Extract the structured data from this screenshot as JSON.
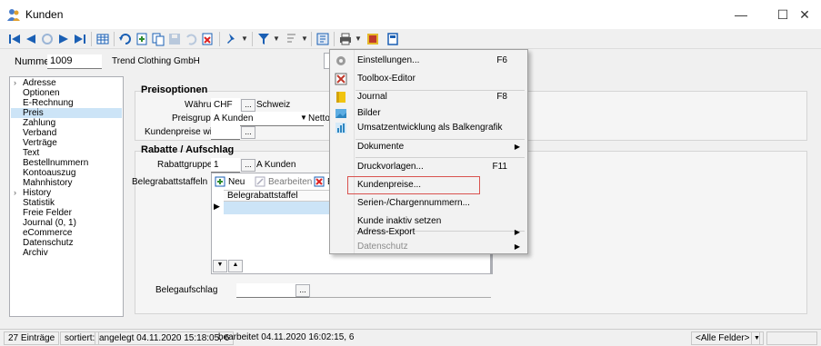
{
  "window": {
    "title": "Kunden",
    "minimize": "—",
    "maximize": "☐",
    "close": "✕"
  },
  "header": {
    "nummer_label": "Nummer",
    "nummer_value": "1009",
    "name_value": "Trend Clothing GmbH"
  },
  "nav": {
    "items": [
      "Adresse",
      "Optionen",
      "E-Rechnung",
      "Preis",
      "Zahlung",
      "Verband",
      "Verträge",
      "Text",
      "Bestellnummern",
      "Kontoauszug",
      "Mahnhistory",
      "History",
      "Statistik",
      "Freie Felder",
      "Journal (0, 1)",
      "eCommerce",
      "Datenschutz",
      "Archiv"
    ],
    "selected": "Preis"
  },
  "preis": {
    "group_title": "Preisoptionen",
    "waehrung_label": "Währung",
    "waehrung_value": "CHF",
    "waehrung_desc": "Schweiz",
    "preisgruppe_label": "Preisgruppe",
    "preisgruppe_value": "A Kunden",
    "netto_label": "Netto",
    "kundenpreise_label": "Kundenpreise wie"
  },
  "rabatte": {
    "group_title": "Rabatte / Aufschlag",
    "rabattgruppe_label": "Rabattgruppe",
    "rabattgruppe_value": "1",
    "rabattgruppe_desc": "A Kunden",
    "belegrabatt_label": "Belegrabattstaffeln",
    "neu_label": "Neu",
    "bearbeiten_label": "Bearbeiten",
    "entfernen_label": "En",
    "column_header": "Belegrabattstaffel",
    "belegaufschlag_label": "Belegaufschlag"
  },
  "menu": {
    "items": [
      {
        "label": "Einstellungen...",
        "key": "F6",
        "icon": "gear-icon"
      },
      {
        "label": "Toolbox-Editor",
        "key": "",
        "icon": "toolbox-icon"
      },
      {
        "label": "Journal",
        "key": "F8",
        "icon": "journal-icon"
      },
      {
        "label": "Bilder",
        "key": "",
        "icon": "picture-icon"
      },
      {
        "label": "Umsatzentwicklung als Balkengrafik",
        "key": "",
        "icon": "bar-chart-icon"
      },
      {
        "label": "Dokumente",
        "key": "",
        "icon": ""
      },
      {
        "label": "Druckvorlagen...",
        "key": "F11",
        "icon": ""
      },
      {
        "label": "Kundenpreise...",
        "key": "",
        "icon": ""
      },
      {
        "label": "Serien-/Chargennummern...",
        "key": "",
        "icon": ""
      },
      {
        "label": "Kunde inaktiv setzen",
        "key": "",
        "icon": ""
      },
      {
        "label": "Adress-Export",
        "key": "",
        "icon": ""
      },
      {
        "label": "Datenschutz",
        "key": "",
        "icon": ""
      }
    ]
  },
  "status": {
    "count": "27 Einträge",
    "sort": "sortiert:",
    "created": "angelegt 04.11.2020 15:18:05, 6",
    "edited": "bearbeitet 04.11.2020 16:02:15, 6",
    "fields": "<Alle Felder>"
  },
  "colors": {
    "selection": "#cce4f7",
    "highlight_border": "#d9534f",
    "menu_bg": "#f2f2f2"
  }
}
